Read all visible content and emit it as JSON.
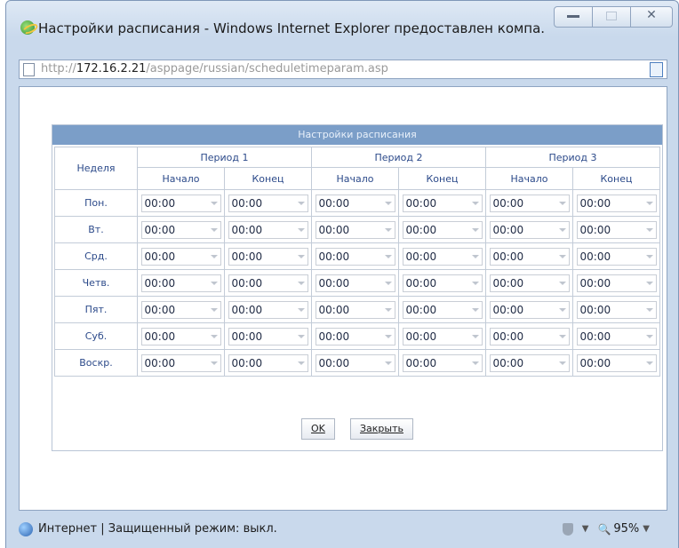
{
  "window": {
    "title": "Настройки расписания - Windows Internet Explorer предоставлен компа...",
    "min_glyph": "",
    "close_glyph": "✕"
  },
  "address": {
    "url_prefix": "http://",
    "url_host": "172.16.2.21",
    "url_path": "/asppage/russian/scheduletimeparam.asp"
  },
  "schedule": {
    "title": "Настройки расписания",
    "day_header": "Неделя",
    "periods": [
      "Период 1",
      "Период 2",
      "Период 3"
    ],
    "start_label": "Начало",
    "end_label": "Конец",
    "days": [
      "Пон.",
      "Вт.",
      "Срд.",
      "Четв.",
      "Пят.",
      "Суб.",
      "Воскр."
    ],
    "time_value": "00:00"
  },
  "buttons": {
    "ok": "OK",
    "close": "Закрыть"
  },
  "statusbar": {
    "text": "Интернет | Защищенный режим: выкл.",
    "zoom": "95%"
  }
}
